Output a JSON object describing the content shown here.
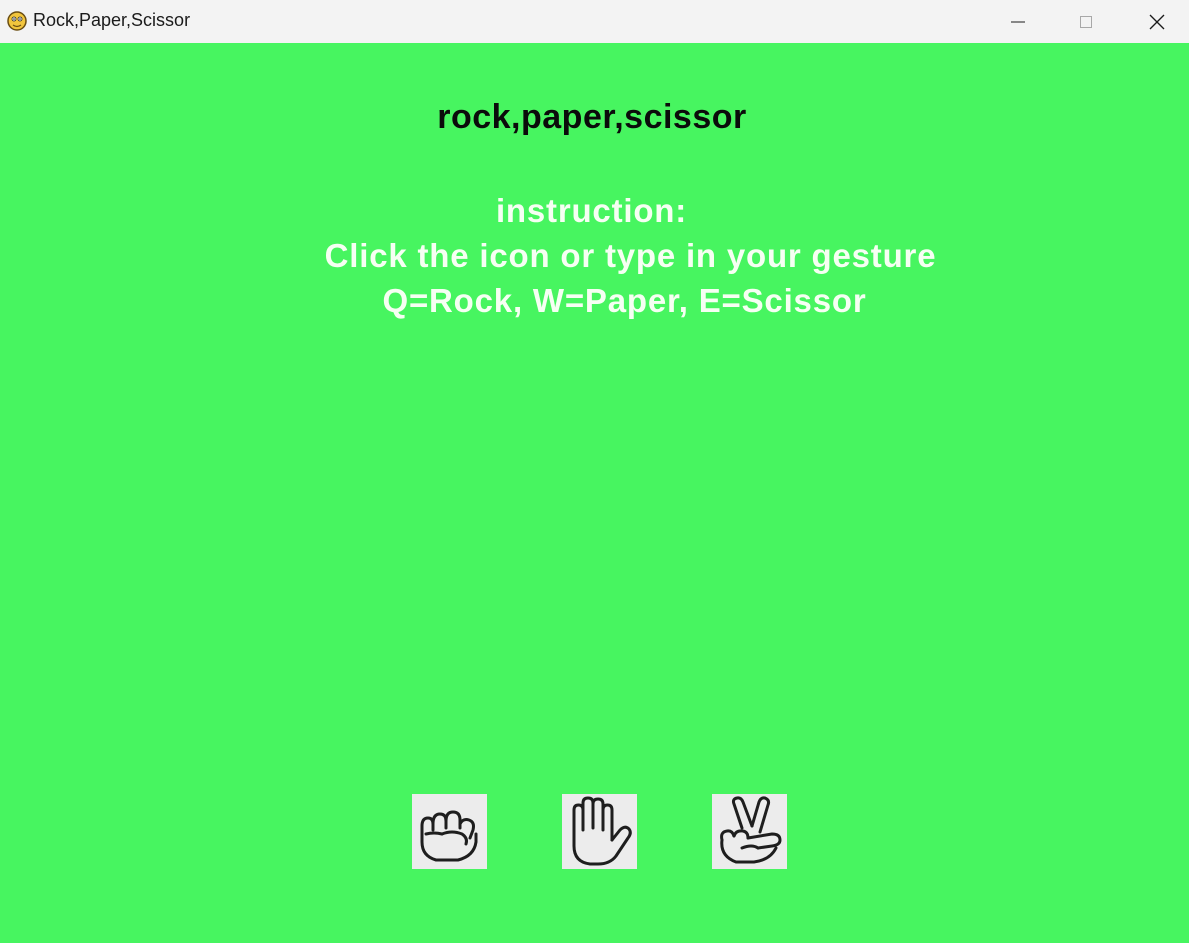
{
  "window": {
    "title": "Rock,Paper,Scissor",
    "app_icon": "python-snake-icon",
    "controls": [
      "minimize-icon",
      "maximize-icon",
      "close-icon"
    ]
  },
  "game": {
    "title": "rock,paper,scissor",
    "instruction_heading": "instruction:",
    "instruction_line1": "Click the icon or type in your gesture",
    "instruction_line2": "Q=Rock, W=Paper, E=Scissor"
  },
  "gestures": [
    {
      "name": "rock",
      "icon": "fist-icon"
    },
    {
      "name": "paper",
      "icon": "open-hand-icon"
    },
    {
      "name": "scissor",
      "icon": "victory-hand-icon"
    }
  ],
  "colors": {
    "background": "#47f560",
    "title_text": "#0b0b0b",
    "instruction_text": "#f6fff3",
    "icon_tile": "#ececec",
    "titlebar": "#f3f3f3"
  }
}
